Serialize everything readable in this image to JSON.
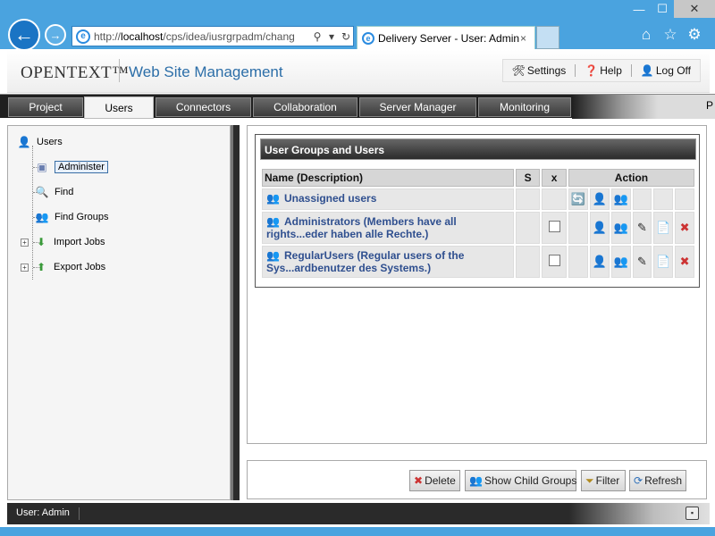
{
  "browser": {
    "url_prefix": "http://",
    "url_host": "localhost",
    "url_path": "/cps/idea/iusrgrpadm/chang",
    "tab_title": "Delivery Server - User: Admin",
    "tab_close": "×",
    "win_min": "—",
    "win_max": "☐",
    "win_close": "✕"
  },
  "header": {
    "brand": "OPENTEXT™",
    "product": "Web Site Management",
    "links": [
      {
        "label": "Settings"
      },
      {
        "label": "Help"
      },
      {
        "label": "Log Off"
      }
    ]
  },
  "tabs": [
    {
      "label": "Project"
    },
    {
      "label": "Users"
    },
    {
      "label": "Connectors"
    },
    {
      "label": "Collaboration"
    },
    {
      "label": "Server Manager"
    },
    {
      "label": "Monitoring"
    }
  ],
  "tabbar_edge_letter": "P",
  "tree": {
    "root": "Users",
    "items": [
      {
        "label": "Administer"
      },
      {
        "label": "Find"
      },
      {
        "label": "Find Groups"
      },
      {
        "label": "Import Jobs"
      },
      {
        "label": "Export Jobs"
      }
    ]
  },
  "groups_panel": {
    "title": "User Groups and Users",
    "columns": {
      "name": "Name (Description)",
      "s": "S",
      "x": "x",
      "action": "Action"
    },
    "rows": [
      {
        "name": "Unassigned users"
      },
      {
        "name": "Administrators (Members have all rights...eder haben alle Rechte.)"
      },
      {
        "name": "RegularUsers (Regular users of the Sys...ardbenutzer des Systems.)"
      }
    ]
  },
  "buttons": {
    "delete": "Delete",
    "show_child_groups": "Show Child Groups",
    "filter": "Filter",
    "refresh": "Refresh"
  },
  "status": {
    "user": "User: Admin"
  },
  "colors": {
    "chrome": "#4aa3df",
    "link_blue": "#2f4f8f",
    "dark_bar": "#1f1f1f"
  }
}
